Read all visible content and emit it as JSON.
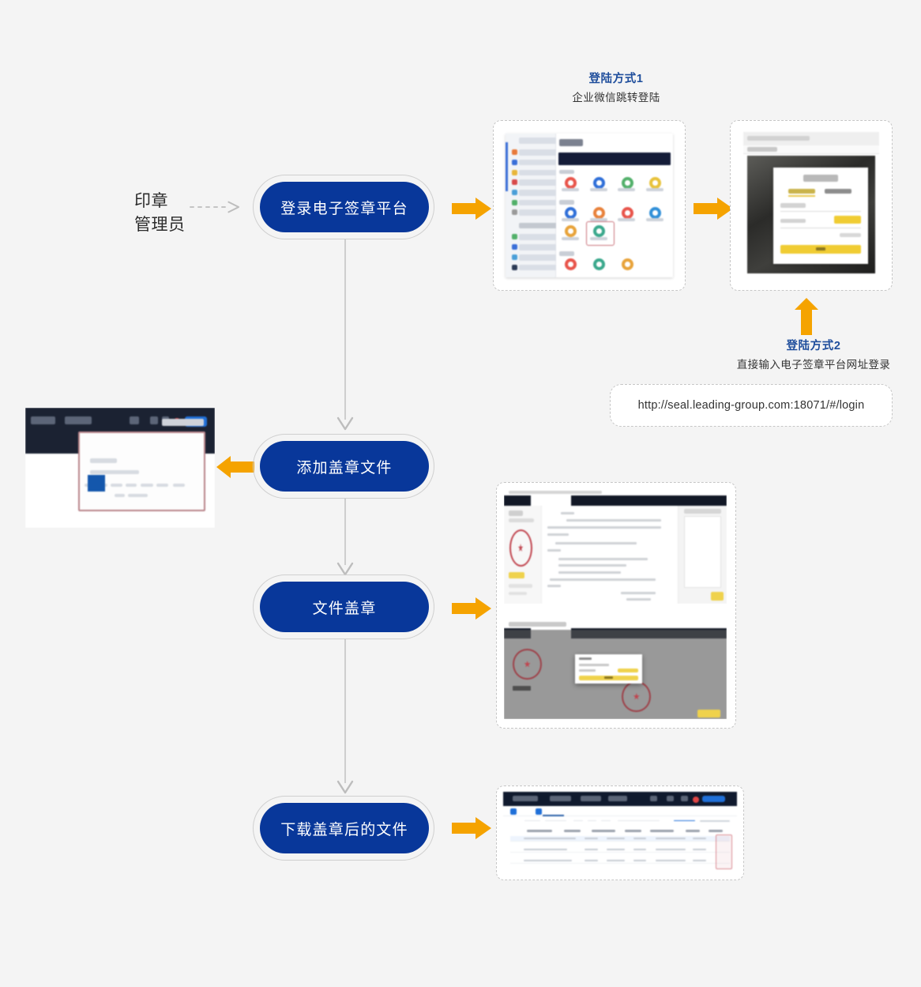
{
  "page": {
    "background": "#f4f4f4",
    "title": "电子签章平台使用流程图"
  },
  "actor": {
    "name": "actor-seal-admin",
    "label": "印章\n管理员",
    "arrow": "dashed-arrow-right"
  },
  "nodes": [
    {
      "id": "login",
      "label": "登录电子签章平台"
    },
    {
      "id": "add-file",
      "label": "添加盖章文件"
    },
    {
      "id": "stamp",
      "label": "文件盖章"
    },
    {
      "id": "download",
      "label": "下载盖章后的文件"
    }
  ],
  "annotations": {
    "login_method_1": {
      "title": "登陆方式1",
      "subtitle": "企业微信跳转登陆"
    },
    "login_method_2": {
      "title": "登陆方式2",
      "subtitle": "直接输入电子签章平台网址登录"
    },
    "login_url": "http://seal.leading-group.com:18071/#/login"
  },
  "screenshots": [
    {
      "id": "wecom-app-grid",
      "caption": "企业微信应用列表截图"
    },
    {
      "id": "seal-login-page",
      "caption": "电子签章平台登录页截图"
    },
    {
      "id": "upload-file-page",
      "caption": "添加盖章文件页面截图"
    },
    {
      "id": "seal-document",
      "caption": "文件盖章页面截图"
    },
    {
      "id": "seal-verify-modal",
      "caption": "盖章验证弹窗截图"
    },
    {
      "id": "download-list",
      "caption": "已盖章文件列表截图"
    }
  ],
  "colors": {
    "node_fill": "#08379a",
    "node_ring": "#cfcfcf",
    "arrow_orange": "#f5a300",
    "connector_gray": "#bdbdbd",
    "heading_blue": "#1f4e9c",
    "dashed_border": "#c6c6c6",
    "background": "#f4f4f4"
  }
}
